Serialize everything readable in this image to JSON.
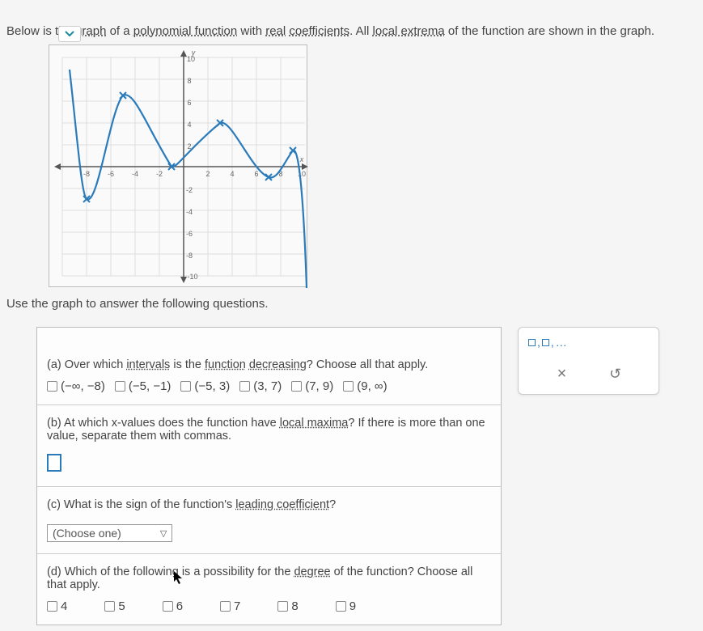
{
  "intro": {
    "pre": "Below is the ",
    "t1": "graph",
    "mid1": " of a ",
    "t2": "polynomial function",
    "mid2": " with ",
    "t3": "real",
    "mid3": " ",
    "t4": "coefficients",
    "mid4": ". All ",
    "t5": "local extrema",
    "post": " of the function are shown in the graph."
  },
  "chart_data": {
    "type": "line",
    "title": "",
    "xlabel": "x",
    "ylabel": "y",
    "xlim": [
      -10,
      10
    ],
    "ylim": [
      -10,
      10
    ],
    "grid": true,
    "series": [
      {
        "name": "polynomial",
        "notable_points": [
          {
            "x": -8,
            "y": -3,
            "kind": "local_min"
          },
          {
            "x": -5,
            "y": 6.5,
            "kind": "local_max"
          },
          {
            "x": -1,
            "y": 0,
            "kind": "local_min"
          },
          {
            "x": 3,
            "y": 4,
            "kind": "local_max"
          },
          {
            "x": 7,
            "y": -1,
            "kind": "local_min"
          },
          {
            "x": 9,
            "y": 1.5,
            "kind": "local_max"
          }
        ]
      }
    ],
    "y_ticks": [
      -10,
      -8,
      -6,
      -4,
      -2,
      2,
      4,
      6,
      8,
      10
    ],
    "x_ticks": [
      -8,
      -6,
      -4,
      -2,
      2,
      4,
      6,
      8,
      10
    ]
  },
  "instruction": "Use the graph to answer the following questions.",
  "qa": {
    "prompt_pre": "(a) Over which ",
    "t1": "intervals",
    "mid1": " is the ",
    "t2": "function",
    "mid2": " ",
    "t3": "decreasing",
    "post": "? Choose all that apply.",
    "options": [
      "(−∞, −8)",
      "(−5, −1)",
      "(−5, 3)",
      "(3, 7)",
      "(7, 9)",
      "(9, ∞)"
    ]
  },
  "qb": {
    "pre": "(b) At which x-values does the function have ",
    "t1": "local maxima",
    "post": "? If there is more than one value, separate them with commas."
  },
  "qc": {
    "pre": "(c) What is the sign of the function's ",
    "t1": "leading coefficient",
    "post": "?",
    "select_placeholder": "(Choose one)"
  },
  "qd": {
    "pre": "(d) Which of the following is a possibility for the ",
    "t1": "degree",
    "post": " of the function? Choose all that apply.",
    "options": [
      "4",
      "5",
      "6",
      "7",
      "8",
      "9"
    ]
  },
  "toolbox": {
    "hint": "…",
    "close": "×",
    "undo": "↺"
  }
}
